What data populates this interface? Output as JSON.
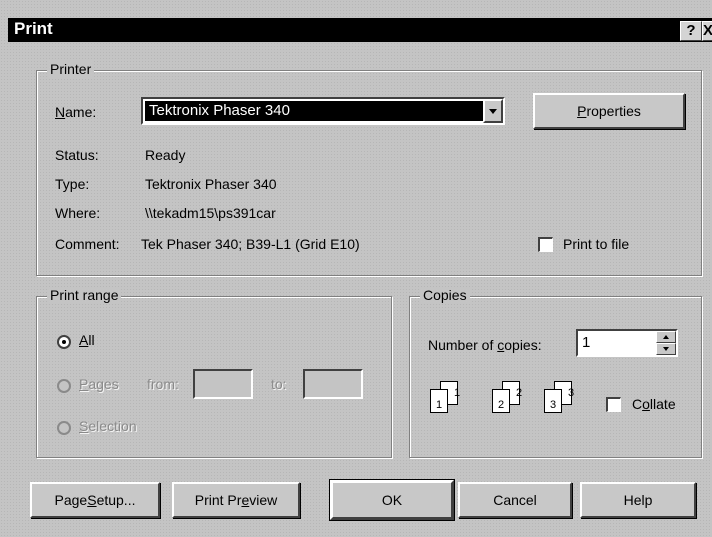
{
  "window": {
    "title": "Print",
    "help_glyph": "?",
    "close_glyph": "X"
  },
  "printer": {
    "legend": "Printer",
    "name_label_prefix": "",
    "name_label_key": "N",
    "name_label_rest": "ame:",
    "name_value": "Tektronix Phaser 340",
    "properties_key": "P",
    "properties_rest": "roperties",
    "status_label": "Status:",
    "status_value": "Ready",
    "type_label": "Type:",
    "type_value": "Tektronix Phaser 340",
    "where_label": "Where:",
    "where_value": "\\\\tekadm15\\ps391car",
    "comment_label": "Comment:",
    "comment_value": "Tek Phaser 340; B39-L1 (Grid E10)",
    "print_to_file_label": "Print to file",
    "print_to_file_checked": false
  },
  "print_range": {
    "legend": "Print range",
    "all_key": "A",
    "all_rest": "ll",
    "all_selected": true,
    "pages_key": "P",
    "pages_rest": "ages",
    "from_label": "from:",
    "from_value": "",
    "to_label": "to:",
    "to_value": "",
    "selection_key": "S",
    "selection_rest": "election"
  },
  "copies": {
    "legend": "Copies",
    "number_prefix": "Number of ",
    "number_key": "c",
    "number_rest": "opies:",
    "number_value": "1",
    "collate_prefix": "C",
    "collate_key": "o",
    "collate_rest": "llate",
    "collate_checked": false,
    "collate_pages": [
      "1",
      "1",
      "2",
      "2",
      "3",
      "3"
    ]
  },
  "buttons": {
    "page_setup_prefix": "Page ",
    "page_setup_key": "S",
    "page_setup_rest": "etup...",
    "print_preview_prefix": "Print Pr",
    "print_preview_key": "e",
    "print_preview_rest": "view",
    "ok": "OK",
    "cancel": "Cancel",
    "help": "Help"
  }
}
